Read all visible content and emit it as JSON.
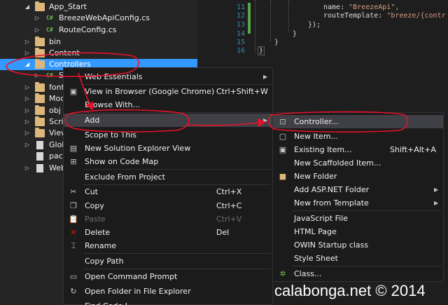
{
  "tree": {
    "items": [
      {
        "label": "App_Start",
        "expanded": true
      },
      {
        "label": "BreezeWebApiConfig.cs",
        "badge": "C#"
      },
      {
        "label": "RouteConfig.cs",
        "badge": "C#"
      },
      {
        "label": "bin"
      },
      {
        "label": "Content"
      },
      {
        "label": "Controllers",
        "expanded": true
      },
      {
        "label": "S",
        "badge": "C#"
      },
      {
        "label": "font"
      },
      {
        "label": "Moc"
      },
      {
        "label": "obj"
      },
      {
        "label": "Scrip"
      },
      {
        "label": "View"
      },
      {
        "label": "Glob"
      },
      {
        "label": "pacl"
      },
      {
        "label": "Web"
      }
    ]
  },
  "editor": {
    "lines": [
      {
        "num": "11",
        "key": "name: ",
        "str": "\"BreezeApi\","
      },
      {
        "num": "12",
        "key": "routeTemplate: ",
        "str": "\"breeze/{contr"
      },
      {
        "num": "13",
        "key": "});",
        "str": ""
      },
      {
        "num": "14",
        "key": "}",
        "str": ""
      },
      {
        "num": "15",
        "key": "}",
        "str": ""
      },
      {
        "num": "16",
        "key": "}",
        "str": ""
      }
    ]
  },
  "context_menu": {
    "items": [
      {
        "label": "Web Essentials",
        "submenu": true
      },
      {
        "label": "View in Browser (Google Chrome)",
        "shortcut": "Ctrl+Shift+W"
      },
      {
        "label": "Browse With..."
      },
      {
        "label": "Add",
        "submenu": true
      },
      {
        "label": "Scope to This"
      },
      {
        "label": "New Solution Explorer View"
      },
      {
        "label": "Show on Code Map"
      },
      {
        "label": "Exclude From Project"
      },
      {
        "label": "Cut",
        "shortcut": "Ctrl+X"
      },
      {
        "label": "Copy",
        "shortcut": "Ctrl+C"
      },
      {
        "label": "Paste",
        "shortcut": "Ctrl+V"
      },
      {
        "label": "Delete",
        "shortcut": "Del"
      },
      {
        "label": "Rename"
      },
      {
        "label": "Copy Path"
      },
      {
        "label": "Open Command Prompt"
      },
      {
        "label": "Open Folder in File Explorer"
      },
      {
        "label": "Find Code I..."
      }
    ]
  },
  "add_submenu": {
    "items": [
      {
        "label": "Controller..."
      },
      {
        "label": "New Item..."
      },
      {
        "label": "Existing Item...",
        "shortcut": "Shift+Alt+A"
      },
      {
        "label": "New Scaffolded Item..."
      },
      {
        "label": "New Folder"
      },
      {
        "label": "Add ASP.NET Folder",
        "submenu": true
      },
      {
        "label": "New from Template",
        "submenu": true
      },
      {
        "label": "JavaScript File"
      },
      {
        "label": "HTML Page"
      },
      {
        "label": "OWIN Startup class"
      },
      {
        "label": "Style Sheet"
      },
      {
        "label": "Class..."
      }
    ]
  },
  "watermark": "calabonga.net © 2014",
  "colors": {
    "selection": "#3399ff",
    "annotation": "#e8102a",
    "menu_bg": "#1b1b1c",
    "delete_icon": "#e51400"
  }
}
